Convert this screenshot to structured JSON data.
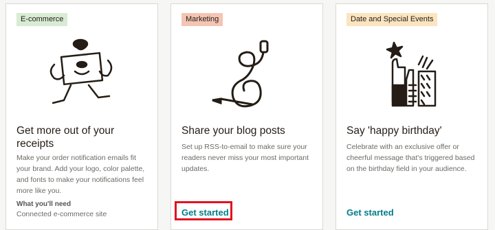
{
  "cards": [
    {
      "badge": "E-commerce",
      "badge_color": "#d8ebd3",
      "illustration": "person-holding-receipt-icon",
      "title": "Get more out of your receipts",
      "description": "Make your order notification emails fit your brand. Add your logo, color palette, and fonts to make your notifications feel more like you.",
      "need_label": "What you'll need",
      "need_value": "Connected e-commerce site"
    },
    {
      "badge": "Marketing",
      "badge_color": "#f4c5b3",
      "illustration": "ampersand-pencil-icon",
      "title": "Share your blog posts",
      "description": "Set up RSS-to-email to make sure your readers never miss your most important updates.",
      "cta": "Get started"
    },
    {
      "badge": "Date and Special Events",
      "badge_color": "#fbe5c0",
      "illustration": "celebrating-hands-icon",
      "title": "Say 'happy birthday'",
      "description": "Celebrate with an exclusive offer or cheerful message that's triggered based on the birthday field in your audience.",
      "cta": "Get started"
    }
  ],
  "colors": {
    "link": "#007c89",
    "highlight": "#e0121f"
  }
}
